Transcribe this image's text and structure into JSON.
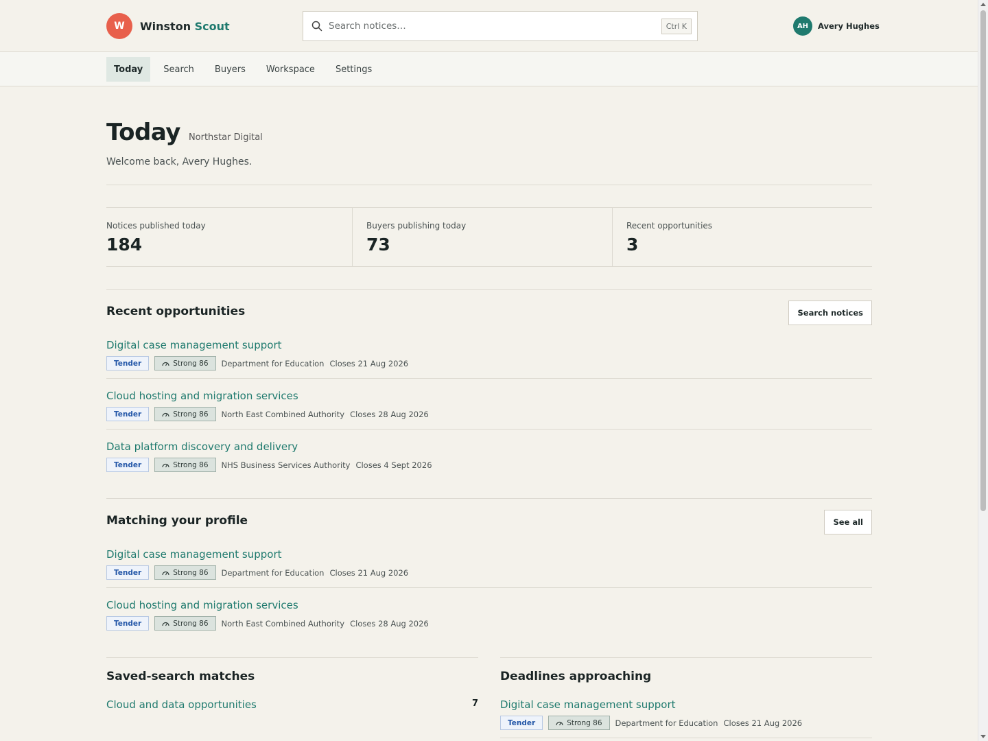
{
  "brand": {
    "logo_letter": "W",
    "name_main": "Winston",
    "name_accent": "Scout"
  },
  "search": {
    "placeholder": "Search notices…",
    "shortcut": "Ctrl K"
  },
  "user": {
    "initials": "AH",
    "name": "Avery Hughes"
  },
  "nav": {
    "items": [
      "Today",
      "Search",
      "Buyers",
      "Workspace",
      "Settings"
    ],
    "active": "Today"
  },
  "page": {
    "title": "Today",
    "org": "Northstar Digital",
    "welcome": "Welcome back, Avery Hughes."
  },
  "stats": [
    {
      "label": "Notices published today",
      "value": "184"
    },
    {
      "label": "Buyers publishing today",
      "value": "73"
    },
    {
      "label": "Recent opportunities",
      "value": "3"
    }
  ],
  "recent": {
    "title": "Recent opportunities",
    "button": "Search notices",
    "items": [
      {
        "title": "Digital case management support",
        "type": "Tender",
        "score": "Strong 86",
        "buyer": "Department for Education",
        "closes": "Closes 21 Aug 2026"
      },
      {
        "title": "Cloud hosting and migration services",
        "type": "Tender",
        "score": "Strong 86",
        "buyer": "North East Combined Authority",
        "closes": "Closes 28 Aug 2026"
      },
      {
        "title": "Data platform discovery and delivery",
        "type": "Tender",
        "score": "Strong 86",
        "buyer": "NHS Business Services Authority",
        "closes": "Closes 4 Sept 2026"
      }
    ]
  },
  "matching": {
    "title": "Matching your profile",
    "button": "See all",
    "items": [
      {
        "title": "Digital case management support",
        "type": "Tender",
        "score": "Strong 86",
        "buyer": "Department for Education",
        "closes": "Closes 21 Aug 2026"
      },
      {
        "title": "Cloud hosting and migration services",
        "type": "Tender",
        "score": "Strong 86",
        "buyer": "North East Combined Authority",
        "closes": "Closes 28 Aug 2026"
      }
    ]
  },
  "saved": {
    "title": "Saved-search matches",
    "items": [
      {
        "name": "Cloud and data opportunities",
        "count": "7"
      }
    ]
  },
  "deadlines": {
    "title": "Deadlines approaching",
    "items": [
      {
        "title": "Digital case management support",
        "type": "Tender",
        "score": "Strong 86",
        "buyer": "Department for Education",
        "closes": "Closes 21 Aug 2026"
      }
    ]
  }
}
